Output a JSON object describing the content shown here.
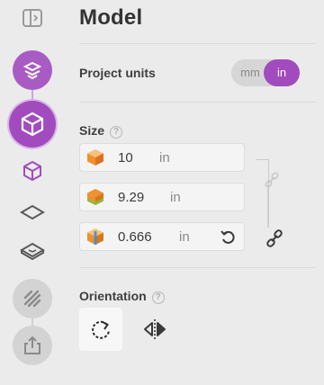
{
  "header": {
    "title": "Model"
  },
  "project_units": {
    "label": "Project units",
    "options": [
      "mm",
      "in"
    ],
    "selected": "in"
  },
  "size": {
    "label": "Size",
    "help": "?",
    "fields": [
      {
        "value": "10",
        "unit": "in"
      },
      {
        "value": "9.29",
        "unit": "in"
      },
      {
        "value": "0.666",
        "unit": "in"
      }
    ]
  },
  "orientation": {
    "label": "Orientation",
    "help": "?"
  },
  "colors": {
    "accent": "#a24bbf",
    "background": "#ebebeb"
  },
  "icons": {
    "sidebar": [
      "panel-toggle-icon",
      "layers-icon",
      "cube-icon",
      "cube-outline-icon",
      "plane-icon",
      "surface-icon",
      "stripes-icon",
      "export-icon"
    ],
    "fields": [
      "cube-x-icon",
      "cube-y-icon",
      "cube-z-icon"
    ],
    "actions": [
      "reset-icon",
      "link-icon",
      "rotate-icon",
      "mirror-icon"
    ]
  }
}
